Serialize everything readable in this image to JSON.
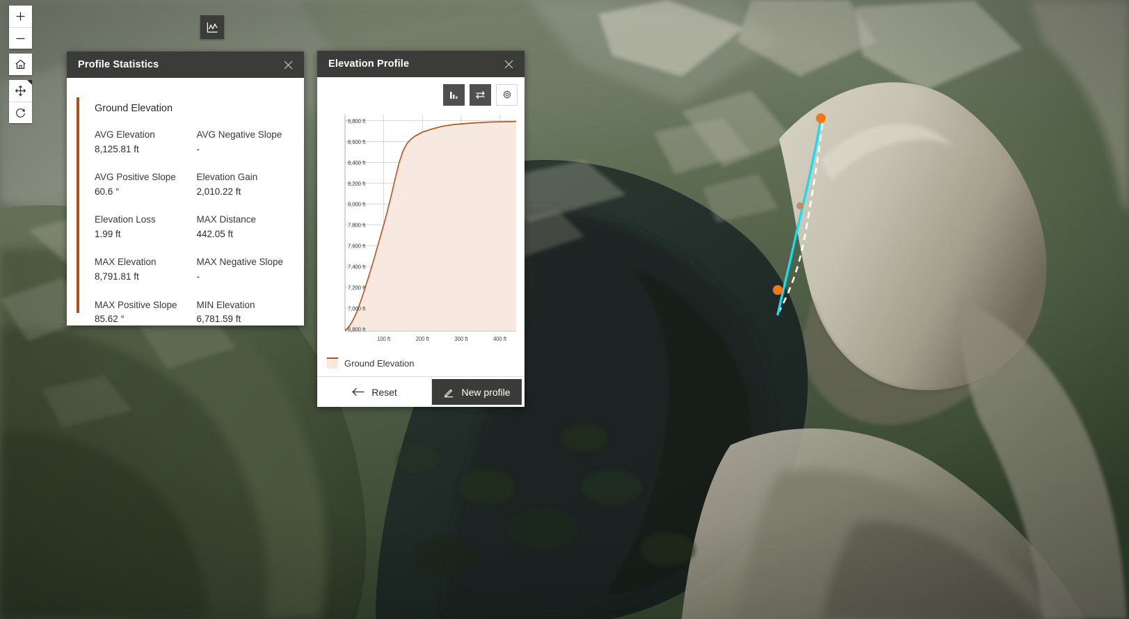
{
  "map_tools": [
    {
      "name": "zoom-in-icon",
      "label": "Zoom in"
    },
    {
      "name": "zoom-out-icon",
      "label": "Zoom out"
    },
    {
      "name": "home-icon",
      "label": "Default view"
    },
    {
      "name": "pan-icon",
      "label": "Pan"
    },
    {
      "name": "compass-icon",
      "label": "Compass / reset rotation"
    }
  ],
  "profile_tool": {
    "label": "Elevation profile",
    "icon": "elevation-profile-icon"
  },
  "stats_panel": {
    "title": "Profile Statistics",
    "close_label": "Close",
    "card_title": "Ground Elevation",
    "accent_color": "#a8531a",
    "stats": [
      {
        "label": "AVG Elevation",
        "value": "8,125.81 ft"
      },
      {
        "label": "AVG Negative Slope",
        "value": "-"
      },
      {
        "label": "AVG Positive Slope",
        "value": "60.6 °"
      },
      {
        "label": "Elevation Gain",
        "value": "2,010.22 ft"
      },
      {
        "label": "Elevation Loss",
        "value": "1.99 ft"
      },
      {
        "label": "MAX Distance",
        "value": "442.05 ft"
      },
      {
        "label": "MAX Elevation",
        "value": "8,791.81 ft"
      },
      {
        "label": "MAX Negative Slope",
        "value": "-"
      },
      {
        "label": "MAX Positive Slope",
        "value": "85.62 °"
      },
      {
        "label": "MIN Elevation",
        "value": "6,781.59 ft"
      }
    ]
  },
  "profile_panel": {
    "title": "Elevation Profile",
    "close_label": "Close",
    "toolbar": [
      {
        "name": "select-chart-icon",
        "label": "Chart statistics",
        "state": "active"
      },
      {
        "name": "swap-axes-icon",
        "label": "Toggle units",
        "state": "active"
      },
      {
        "name": "gear-icon",
        "label": "Settings",
        "state": "plain"
      }
    ],
    "legend": [
      {
        "label": "Ground Elevation",
        "line_color": "#b4551c",
        "fill_color": "#f7e8e0"
      }
    ],
    "footer": {
      "reset_label": "Reset",
      "reset_icon": "arrow-left-icon",
      "new_profile_label": "New profile",
      "new_profile_icon": "pencil-icon"
    }
  },
  "chart_data": {
    "type": "area",
    "title": "Ground Elevation",
    "xlabel": "",
    "ylabel": "",
    "xlim": [
      0,
      442.05
    ],
    "ylim": [
      6781.59,
      8791.81
    ],
    "xticks": [
      100,
      200,
      300,
      400
    ],
    "xtick_labels": [
      "100 ft",
      "200 ft",
      "300 ft",
      "400 ft"
    ],
    "yticks": [
      6800,
      7000,
      7200,
      7400,
      7600,
      7800,
      8000,
      8200,
      8400,
      8600,
      8800
    ],
    "ytick_labels": [
      "6,800 ft",
      "7,000 ft",
      "7,200 ft",
      "7,400 ft",
      "7,600 ft",
      "7,800 ft",
      "8,000 ft",
      "8,200 ft",
      "8,400 ft",
      "8,600 ft",
      "8,800 ft"
    ],
    "grid": true,
    "legend_position": "below",
    "line_color": "#b4551c",
    "fill_color": "#f7e8e0",
    "series": [
      {
        "name": "Ground Elevation",
        "x": [
          0,
          10,
          20,
          30,
          40,
          50,
          60,
          70,
          80,
          90,
          100,
          110,
          120,
          130,
          140,
          150,
          160,
          170,
          180,
          200,
          220,
          250,
          280,
          310,
          340,
          370,
          400,
          442.05
        ],
        "y": [
          6781.59,
          6820,
          6880,
          6960,
          7060,
          7170,
          7290,
          7410,
          7540,
          7670,
          7800,
          7940,
          8090,
          8250,
          8400,
          8510,
          8580,
          8620,
          8650,
          8690,
          8715,
          8745,
          8762,
          8772,
          8780,
          8786,
          8789,
          8791.81
        ]
      }
    ]
  },
  "map_overlay": {
    "measure_line_color": "#16dcf0",
    "guide_line_color": "#ffffff",
    "endpoint_color": "#f07818",
    "midpoint_color": "#c08a64"
  }
}
